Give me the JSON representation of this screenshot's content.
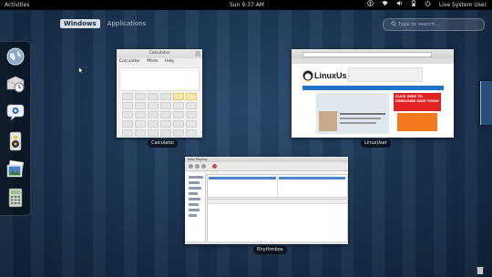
{
  "top_bar": {
    "activities": "Activities",
    "clock": "Sun  9:37 AM",
    "user": "Live System User",
    "icons": [
      "accessibility-icon",
      "network-icon",
      "volume-icon",
      "battery-icon",
      "power-icon"
    ]
  },
  "view_selector": {
    "tabs": [
      {
        "label": "Windows",
        "active": true
      },
      {
        "label": "Applications",
        "active": false
      }
    ]
  },
  "search": {
    "placeholder": "Type to search..."
  },
  "dash": {
    "items": [
      "globe-browser-icon",
      "mail-clock-icon",
      "chat-empathy-icon",
      "speaker-rhythmbox-icon",
      "photos-icon",
      "calculator-icon"
    ]
  },
  "windows": [
    {
      "id": "calculator",
      "label": "Calculator",
      "title": "Calculator",
      "menu": [
        "Calculator",
        "Mode",
        "Help"
      ]
    },
    {
      "id": "linuxuser",
      "label": "LinuxUser",
      "logo_text": "LinuxUser",
      "promo_text": "CLICK HERE TO SUBSCRIBE SAVE TODAY"
    },
    {
      "id": "rhythmbox",
      "label": "Rhythmbox",
      "title": "Now Playing"
    }
  ],
  "colors": {
    "background": "#1a3352",
    "topbar": "#000000",
    "linuxuser_nav": "#1f73c9",
    "promo_red": "#e02424",
    "promo_orange": "#f47a20"
  }
}
